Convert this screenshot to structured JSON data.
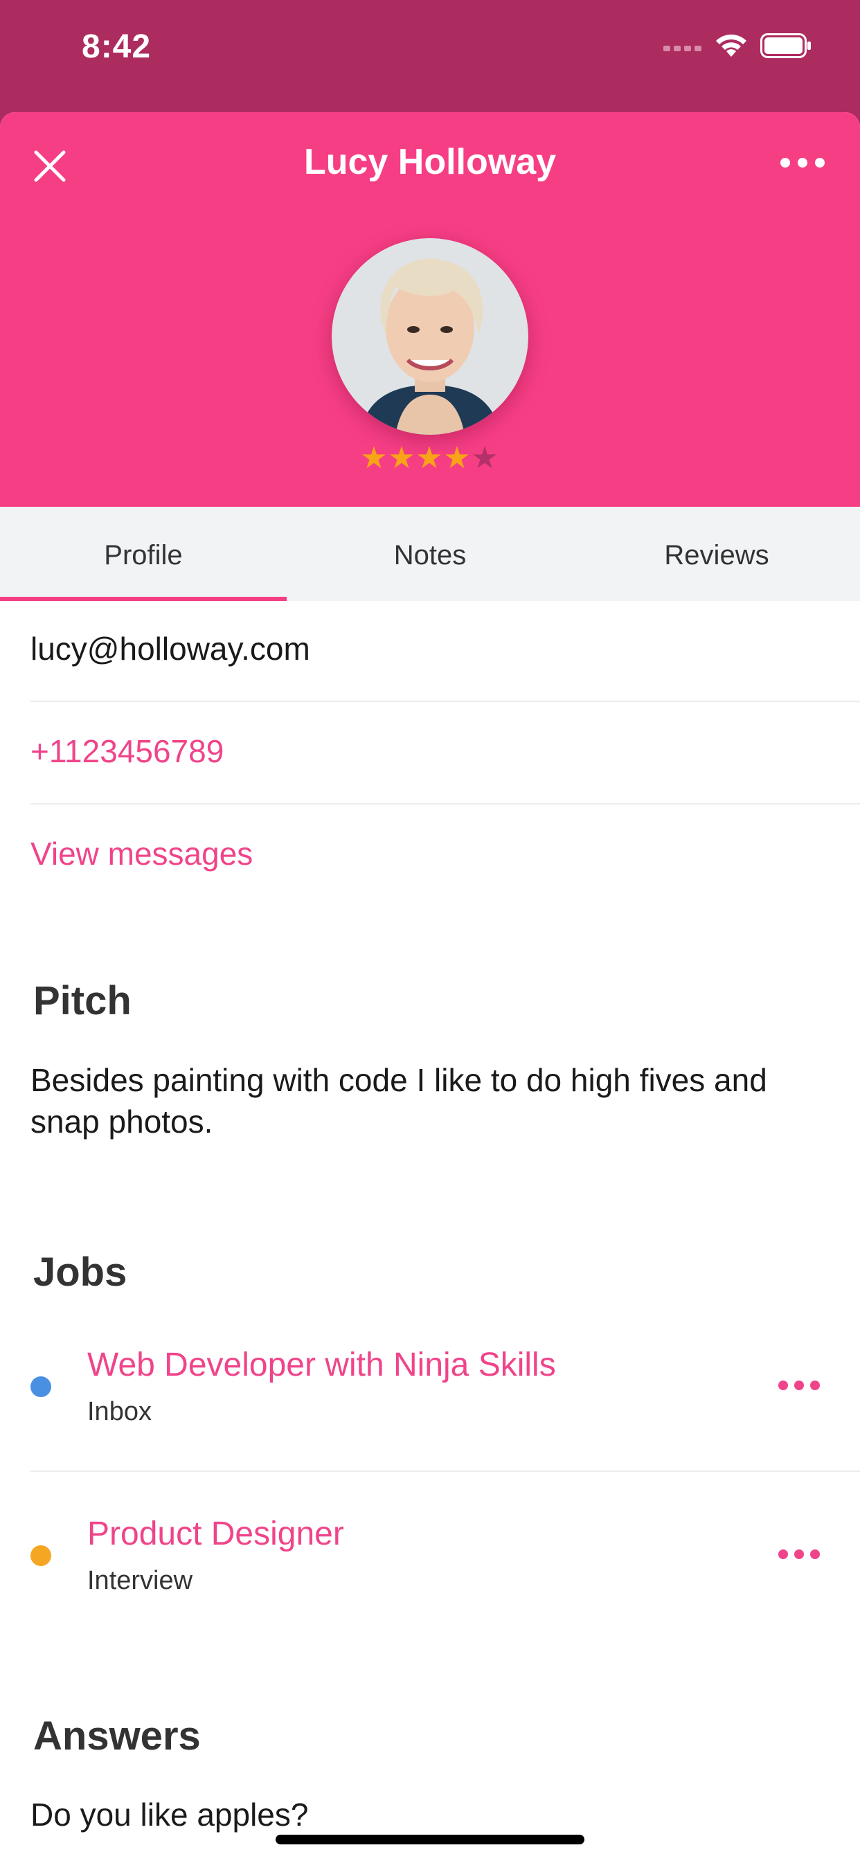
{
  "status_bar": {
    "time": "8:42"
  },
  "header": {
    "title": "Lucy Holloway",
    "rating": 4,
    "rating_max": 5
  },
  "tabs": [
    {
      "label": "Profile",
      "active": true
    },
    {
      "label": "Notes",
      "active": false
    },
    {
      "label": "Reviews",
      "active": false
    }
  ],
  "contact": {
    "email": "lucy@holloway.com",
    "phone": "+1123456789",
    "view_messages": "View messages"
  },
  "pitch": {
    "heading": "Pitch",
    "text": "Besides painting with code I like to do high fives and snap photos."
  },
  "jobs": {
    "heading": "Jobs",
    "items": [
      {
        "title": "Web Developer with Ninja Skills",
        "status": "Inbox",
        "dot_color": "#4a90e2"
      },
      {
        "title": "Product Designer",
        "status": "Interview",
        "dot_color": "#f5a623"
      }
    ]
  },
  "answers": {
    "heading": "Answers",
    "question": "Do you like apples?"
  },
  "colors": {
    "accent": "#f63e85",
    "status_bar": "#ad2c60",
    "link": "#f0448a",
    "star_on": "#f8a318"
  },
  "icons": [
    "close-icon",
    "more-icon",
    "wifi-icon",
    "battery-icon",
    "signal-icon",
    "star-icon"
  ]
}
